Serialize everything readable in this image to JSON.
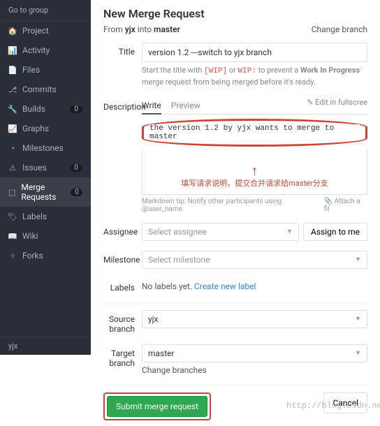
{
  "sidebar": {
    "top": "Go to group",
    "items": [
      {
        "icon": "🏠",
        "label": "Project"
      },
      {
        "icon": "📊",
        "label": "Activity"
      },
      {
        "icon": "📄",
        "label": "Files"
      },
      {
        "icon": "⎇",
        "label": "Commits"
      },
      {
        "icon": "🔧",
        "label": "Builds",
        "badge": "0"
      },
      {
        "icon": "📈",
        "label": "Graphs"
      },
      {
        "icon": "◔",
        "label": "Milestones"
      },
      {
        "icon": "⚠",
        "label": "Issues",
        "badge": "0"
      },
      {
        "icon": "⬚",
        "label": "Merge Requests",
        "badge": "0",
        "active": true
      },
      {
        "icon": "🏷",
        "label": "Labels"
      },
      {
        "icon": "📖",
        "label": "Wiki"
      },
      {
        "icon": "⑂",
        "label": "Forks"
      }
    ],
    "footer": "yjx"
  },
  "page": {
    "title": "New Merge Request",
    "from_prefix": "From",
    "from_branch": "yjx",
    "into_word": "into",
    "to_branch": "master",
    "change_branch": "Change branch"
  },
  "form": {
    "title_label": "Title",
    "title_value": "version 1.2 ---switch to yjx branch",
    "title_hint_prefix": "Start the title with ",
    "wip1": "[WIP]",
    "or": " or ",
    "wip2": "WIP:",
    "title_hint_mid": " to prevent a ",
    "title_hint_bold": "Work In Progress",
    "title_hint_suffix": " merge request from being merged before it's ready.",
    "desc_label": "Description",
    "tab_write": "Write",
    "tab_preview": "Preview",
    "edit_full": "✎ Edit in fullscree",
    "desc_value": "the version 1.2 by yjx wants to merge to master",
    "annotation": "填写请求说明，提交合并请求给master分支",
    "md_hint": "Markdown tip: Notify other participants using @user_name",
    "attach": "📎 Attach a fil",
    "assignee_label": "Assignee",
    "assignee_placeholder": "Select assignee",
    "assign_me": "Assign to me",
    "milestone_label": "Milestone",
    "milestone_placeholder": "Select milestone",
    "labels_label": "Labels",
    "labels_text": "No labels yet. ",
    "labels_link": "Create new label",
    "source_label": "Source branch",
    "source_value": "yjx",
    "target_label": "Target branch",
    "target_value": "master",
    "change_branches": "Change branches",
    "submit": "Submit merge request",
    "cancel": "Cancel"
  },
  "watermark": "http://blog.csdn.net/Adelly"
}
